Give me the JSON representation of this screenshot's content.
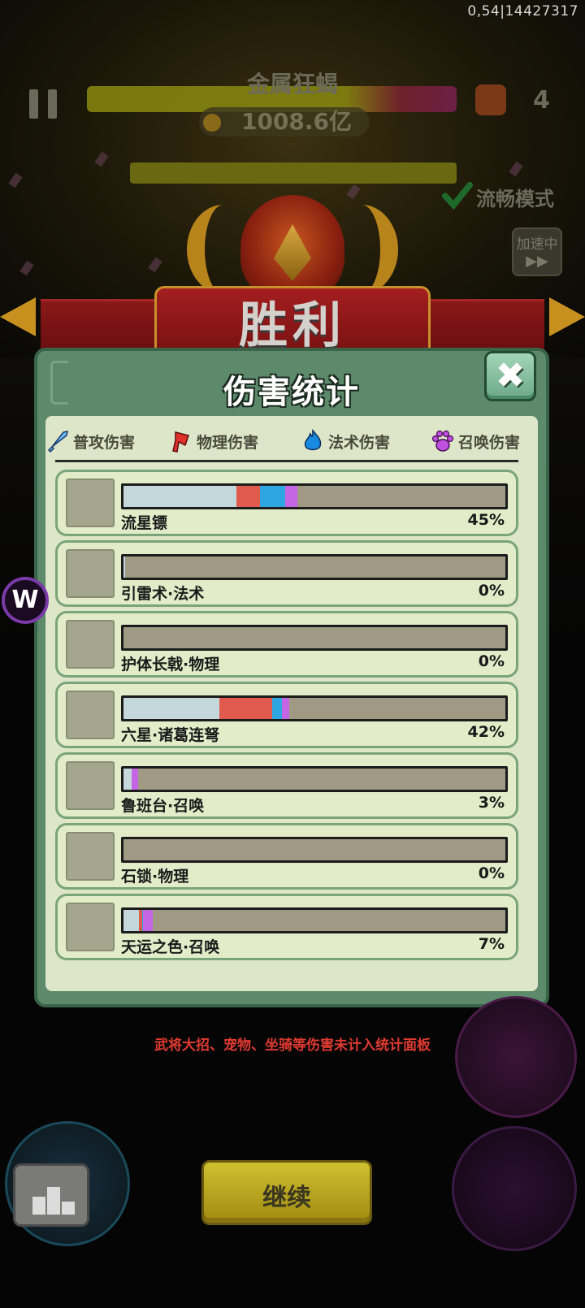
{
  "debug_text": "0,54|14427317",
  "boss": {
    "name": "金属狂蝎",
    "hp": "1008.6亿"
  },
  "wave_count": "4",
  "smooth_mode_label": "流畅模式",
  "speed_button": {
    "line1": "加速中",
    "line2": "▶▶"
  },
  "victory_label": "胜利",
  "panel": {
    "title": "伤害统计",
    "close_label": "✖",
    "legend": [
      {
        "label": "普攻伤害",
        "icon": "sword-icon",
        "color": "#2ea6e2"
      },
      {
        "label": "物理伤害",
        "icon": "axe-icon",
        "color": "#e03a30"
      },
      {
        "label": "法术伤害",
        "icon": "flame-icon",
        "color": "#1a8ae0"
      },
      {
        "label": "召唤伤害",
        "icon": "paw-icon",
        "color": "#c050e0"
      }
    ],
    "rows": [
      {
        "name": "流星镖",
        "percent": "45%",
        "icon": "shuriken-icon",
        "segments": {
          "basic": 0.295,
          "phys": 0.063,
          "magic": 0.065,
          "summ": 0.032
        }
      },
      {
        "name": "引雷术·法术",
        "percent": "0%",
        "icon": "lightning-icon",
        "segments": {
          "basic": 0.004,
          "phys": 0,
          "magic": 0,
          "summ": 0
        }
      },
      {
        "name": "护体长戟·物理",
        "percent": "0%",
        "icon": "halberd-icon",
        "segments": {
          "basic": 0,
          "phys": 0,
          "magic": 0,
          "summ": 0
        }
      },
      {
        "name": "六星·诸葛连弩",
        "percent": "42%",
        "icon": "crossbow-icon",
        "segments": {
          "basic": 0.25,
          "phys": 0.14,
          "magic": 0.025,
          "summ": 0.018
        }
      },
      {
        "name": "鲁班台·召唤",
        "percent": "3%",
        "icon": "luban-platform-icon",
        "segments": {
          "basic": 0.022,
          "phys": 0,
          "magic": 0,
          "summ": 0.017
        }
      },
      {
        "name": "石锁·物理",
        "percent": "0%",
        "icon": "stone-lock-icon",
        "segments": {
          "basic": 0,
          "phys": 0,
          "magic": 0,
          "summ": 0
        }
      },
      {
        "name": "天运之色·召唤",
        "percent": "7%",
        "icon": "dice-icon",
        "segments": {
          "basic": 0.04,
          "phys": 0.008,
          "magic": 0.004,
          "summ": 0.024
        }
      }
    ]
  },
  "note": "武将大招、宠物、坐骑等伤害未计入统计面板",
  "continue_label": "继续",
  "side_badge": "W"
}
